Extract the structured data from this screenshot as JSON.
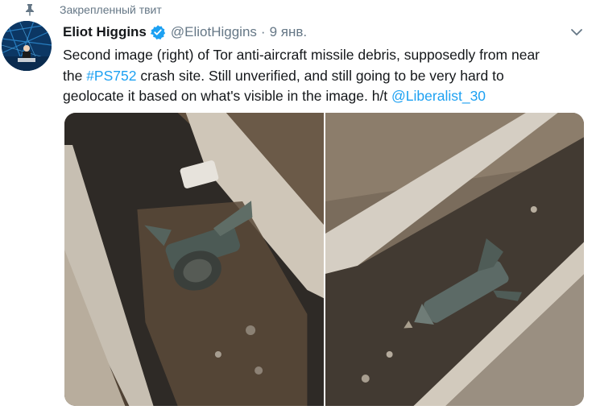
{
  "pinned": {
    "label": "Закрепленный твит",
    "icon": "pin-icon"
  },
  "author": {
    "display_name": "Eliot Higgins",
    "verified": true,
    "handle": "@EliotHiggins",
    "separator": "·",
    "timestamp": "9 янв."
  },
  "tweet": {
    "text_before_hashtag": "Second image (right) of Tor anti-aircraft missile debris, supposedly from near the ",
    "hashtag": "#PS752",
    "text_after_hashtag": " crash site. Still unverified, and still going to be very hard to geolocate it based on what's visible in the image. h/t ",
    "mention": "@Liberalist_30"
  },
  "media": {
    "photos": [
      {
        "subject": "missile debris in roadside ditch (left)"
      },
      {
        "subject": "missile debris in roadside ditch (right)"
      }
    ]
  },
  "colors": {
    "link": "#1da1f2",
    "secondary_text": "#657786",
    "verified_badge": "#1da1f2"
  }
}
